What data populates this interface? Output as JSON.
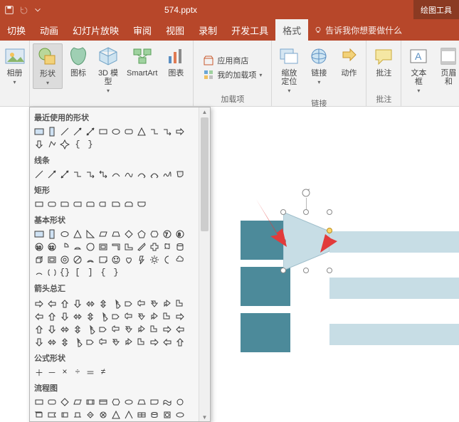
{
  "titlebar": {
    "filename": "574.pptx",
    "context_tab": "绘图工具"
  },
  "tabs": {
    "items": [
      "切换",
      "动画",
      "幻灯片放映",
      "审阅",
      "视图",
      "录制",
      "开发工具",
      "格式"
    ],
    "active_index": 7,
    "tellme": "告诉我你想要做什么"
  },
  "ribbon": {
    "group_images": {
      "label": "相册",
      "album": "相册"
    },
    "group_illustrations": {
      "shapes": "形状",
      "icons": "图标",
      "models3d": "3D 模型",
      "smartart": "SmartArt",
      "chart": "图表"
    },
    "group_addins": {
      "label": "加载项",
      "store": "应用商店",
      "myaddins": "我的加载项"
    },
    "group_links": {
      "label": "链接",
      "zoom": "缩放定位",
      "link": "链接",
      "action": "动作"
    },
    "group_comments": {
      "label": "批注",
      "comment": "批注"
    },
    "group_text": {
      "textbox": "文本框",
      "headerfooter": "页眉和"
    }
  },
  "shapes_panel": {
    "categories": {
      "recent": "最近使用的形状",
      "lines": "线条",
      "rects": "矩形",
      "basic": "基本形状",
      "arrows": "箭头总汇",
      "equations": "公式形状",
      "flowchart": "流程图"
    }
  }
}
